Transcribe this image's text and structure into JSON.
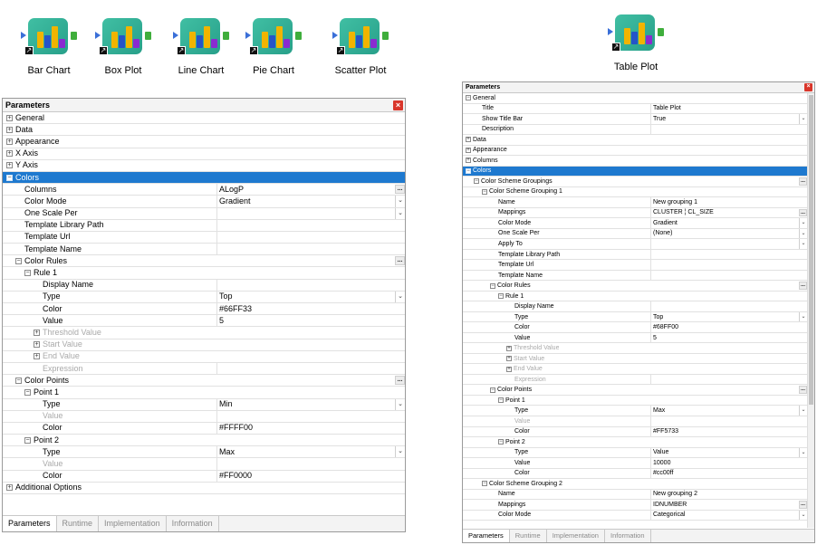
{
  "nodes": [
    {
      "label": "Bar Chart"
    },
    {
      "label": "Box Plot"
    },
    {
      "label": "Line Chart"
    },
    {
      "label": "Pie Chart"
    },
    {
      "label": "Scatter Plot"
    },
    {
      "label": "Table Plot"
    }
  ],
  "icons": {
    "close": "close-icon",
    "expand": "plus-icon",
    "collapse": "minus-icon",
    "dropdown": "chevron-down-icon",
    "ellipsis": "ellipsis-icon"
  },
  "colors": {
    "selection": "#1e79cf",
    "close": "#d9362b"
  },
  "left_panel": {
    "title": "Parameters",
    "rows": [
      {
        "name": "General",
        "level": 0,
        "expander": "+",
        "full": true
      },
      {
        "name": "Data",
        "level": 0,
        "expander": "+",
        "full": true
      },
      {
        "name": "Appearance",
        "level": 0,
        "expander": "+",
        "full": true
      },
      {
        "name": "X Axis",
        "level": 0,
        "expander": "+",
        "full": true
      },
      {
        "name": "Y Axis",
        "level": 0,
        "expander": "+",
        "full": true
      },
      {
        "name": "Colors",
        "level": 0,
        "expander": "-",
        "full": true,
        "selected": true
      },
      {
        "name": "Columns",
        "level": 1,
        "value": "ALogP",
        "ellipsis": true
      },
      {
        "name": "Color Mode",
        "level": 1,
        "value": "Gradient",
        "dropdown": true
      },
      {
        "name": "One Scale Per",
        "level": 1,
        "value": "",
        "dropdown": true
      },
      {
        "name": "Template Library Path",
        "level": 1,
        "value": ""
      },
      {
        "name": "Template Url",
        "level": 1,
        "value": ""
      },
      {
        "name": "Template Name",
        "level": 1,
        "value": ""
      },
      {
        "name": "Color Rules",
        "level": 1,
        "expander": "-",
        "full": true,
        "ellipsis": true
      },
      {
        "name": "Rule 1",
        "level": 2,
        "expander": "-",
        "full": true
      },
      {
        "name": "Display Name",
        "level": 3,
        "value": ""
      },
      {
        "name": "Type",
        "level": 3,
        "value": "Top",
        "dropdown": true
      },
      {
        "name": "Color",
        "level": 3,
        "value": "#66FF33"
      },
      {
        "name": "Value",
        "level": 3,
        "value": "5"
      },
      {
        "name": "Threshold Value",
        "level": 3,
        "expander": "+",
        "full": true,
        "disabled": true
      },
      {
        "name": "Start Value",
        "level": 3,
        "expander": "+",
        "full": true,
        "disabled": true
      },
      {
        "name": "End Value",
        "level": 3,
        "expander": "+",
        "full": true,
        "disabled": true
      },
      {
        "name": "Expression",
        "level": 3,
        "value": "",
        "disabled": true
      },
      {
        "name": "Color Points",
        "level": 1,
        "expander": "-",
        "full": true,
        "ellipsis": true
      },
      {
        "name": "Point 1",
        "level": 2,
        "expander": "-",
        "full": true
      },
      {
        "name": "Type",
        "level": 3,
        "value": "Min",
        "dropdown": true
      },
      {
        "name": "Value",
        "level": 3,
        "value": "",
        "disabled": true
      },
      {
        "name": "Color",
        "level": 3,
        "value": "#FFFF00"
      },
      {
        "name": "Point 2",
        "level": 2,
        "expander": "-",
        "full": true
      },
      {
        "name": "Type",
        "level": 3,
        "value": "Max",
        "dropdown": true
      },
      {
        "name": "Value",
        "level": 3,
        "value": "",
        "disabled": true
      },
      {
        "name": "Color",
        "level": 3,
        "value": "#FF0000"
      },
      {
        "name": "Additional Options",
        "level": 0,
        "expander": "+",
        "full": true
      }
    ],
    "tabs": [
      {
        "label": "Parameters",
        "active": true
      },
      {
        "label": "Runtime"
      },
      {
        "label": "Implementation"
      },
      {
        "label": "Information"
      }
    ]
  },
  "right_panel": {
    "title": "Parameters",
    "rows": [
      {
        "name": "General",
        "level": 0,
        "expander": "-",
        "full": true
      },
      {
        "name": "Title",
        "level": 1,
        "value": "Table Plot"
      },
      {
        "name": "Show Title Bar",
        "level": 1,
        "value": "True",
        "dropdown": true
      },
      {
        "name": "Description",
        "level": 1,
        "value": ""
      },
      {
        "name": "Data",
        "level": 0,
        "expander": "+",
        "full": true
      },
      {
        "name": "Appearance",
        "level": 0,
        "expander": "+",
        "full": true
      },
      {
        "name": "Columns",
        "level": 0,
        "expander": "+",
        "full": true
      },
      {
        "name": "Colors",
        "level": 0,
        "expander": "-",
        "full": true,
        "selected": true
      },
      {
        "name": "Color Scheme Groupings",
        "level": 1,
        "expander": "-",
        "full": true,
        "ellipsis": true
      },
      {
        "name": "Color Scheme Grouping 1",
        "level": 2,
        "expander": "-",
        "full": true
      },
      {
        "name": "Name",
        "level": 3,
        "value": "New grouping 1"
      },
      {
        "name": "Mappings",
        "level": 3,
        "value": "CLUSTER ¦ CL_SIZE",
        "ellipsis": true
      },
      {
        "name": "Color Mode",
        "level": 3,
        "value": "Gradient",
        "dropdown": true
      },
      {
        "name": "One Scale Per",
        "level": 3,
        "value": "(None)",
        "dropdown": true
      },
      {
        "name": "Apply To",
        "level": 3,
        "value": "",
        "dropdown": true
      },
      {
        "name": "Template Library Path",
        "level": 3,
        "value": ""
      },
      {
        "name": "Template Url",
        "level": 3,
        "value": ""
      },
      {
        "name": "Template Name",
        "level": 3,
        "value": ""
      },
      {
        "name": "Color Rules",
        "level": 3,
        "expander": "-",
        "full": true,
        "ellipsis": true
      },
      {
        "name": "Rule 1",
        "level": 4,
        "expander": "-",
        "full": true
      },
      {
        "name": "Display Name",
        "level": 5,
        "value": ""
      },
      {
        "name": "Type",
        "level": 5,
        "value": "Top",
        "dropdown": true
      },
      {
        "name": "Color",
        "level": 5,
        "value": "#68FF00"
      },
      {
        "name": "Value",
        "level": 5,
        "value": "5"
      },
      {
        "name": "Threshold Value",
        "level": 5,
        "expander": "+",
        "full": true,
        "disabled": true
      },
      {
        "name": "Start Value",
        "level": 5,
        "expander": "+",
        "full": true,
        "disabled": true
      },
      {
        "name": "End Value",
        "level": 5,
        "expander": "+",
        "full": true,
        "disabled": true
      },
      {
        "name": "Expression",
        "level": 5,
        "value": "",
        "disabled": true
      },
      {
        "name": "Color Points",
        "level": 3,
        "expander": "-",
        "full": true,
        "ellipsis": true
      },
      {
        "name": "Point 1",
        "level": 4,
        "expander": "-",
        "full": true
      },
      {
        "name": "Type",
        "level": 5,
        "value": "Max",
        "dropdown": true
      },
      {
        "name": "Value",
        "level": 5,
        "value": "",
        "disabled": true
      },
      {
        "name": "Color",
        "level": 5,
        "value": "#FF5733"
      },
      {
        "name": "Point 2",
        "level": 4,
        "expander": "-",
        "full": true
      },
      {
        "name": "Type",
        "level": 5,
        "value": "Value",
        "dropdown": true
      },
      {
        "name": "Value",
        "level": 5,
        "value": "10000"
      },
      {
        "name": "Color",
        "level": 5,
        "value": "#cc00ff"
      },
      {
        "name": "Color Scheme Grouping 2",
        "level": 2,
        "expander": "-",
        "full": true
      },
      {
        "name": "Name",
        "level": 3,
        "value": "New grouping 2"
      },
      {
        "name": "Mappings",
        "level": 3,
        "value": "IDNUMBER",
        "ellipsis": true
      },
      {
        "name": "Color Mode",
        "level": 3,
        "value": "Categorical",
        "dropdown": true
      }
    ],
    "tabs": [
      {
        "label": "Parameters",
        "active": true
      },
      {
        "label": "Runtime"
      },
      {
        "label": "Implementation"
      },
      {
        "label": "Information"
      }
    ]
  }
}
